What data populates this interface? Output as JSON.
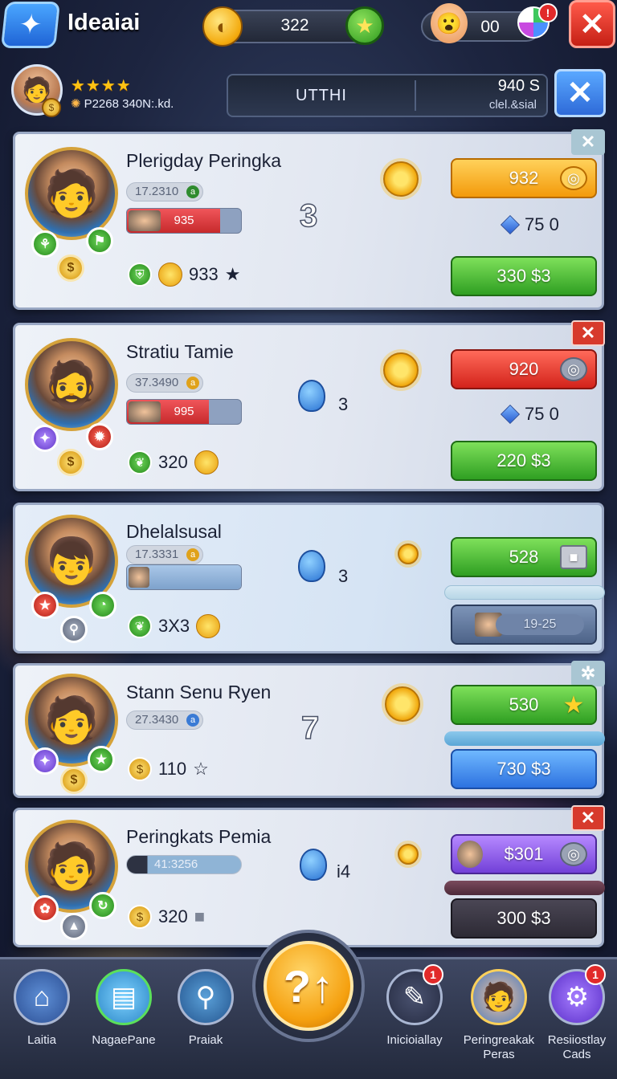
{
  "header": {
    "title": "Ideaiai",
    "logo_icon": "star-puzzle-icon",
    "coins": "322",
    "gems": "00",
    "globe_badge": "!",
    "close_label": "✕"
  },
  "profile": {
    "stars": "★★★★",
    "stats_text": "P2268  340N:.kd.",
    "search_text": "UTTHI",
    "stat_top": "940 S",
    "stat_bottom": "clel.&sial",
    "close_label": "✕"
  },
  "cards": [
    {
      "name": "Plerigday Peringka",
      "level": "17.2310",
      "hp": "935",
      "hp_fill": 0.82,
      "rank": "3",
      "stat": "933",
      "btn1": "932",
      "btn1_color": "yellow",
      "gem_line": "75 0",
      "btn2": "330 $3",
      "btn2_color": "green",
      "close_style": "teal"
    },
    {
      "name": "Stratiu Tamie",
      "level": "37.3490",
      "hp": "995",
      "hp_fill": 0.72,
      "rank": "3",
      "stat": "320",
      "btn1": "920",
      "btn1_color": "red",
      "gem_line": "75 0",
      "btn2": "220 $3",
      "btn2_color": "green",
      "close_style": "red"
    },
    {
      "name": "Dhelalsusal",
      "level": "17.3331",
      "hp": "",
      "hp_fill": 0,
      "rank": "3",
      "stat": "3X3",
      "btn1": "528",
      "btn1_color": "green",
      "time": "19-25",
      "close_style": "none"
    },
    {
      "name": "Stann Senu Ryen",
      "level": "27.3430",
      "rank": "7",
      "stat": "110",
      "btn1": "530",
      "btn1_color": "green",
      "btn2": "730 $3",
      "btn2_color": "blue",
      "close_style": "teal"
    },
    {
      "name": "Peringkats Pemia",
      "level": "41:3256",
      "rank": "i4",
      "stat": "320",
      "btn1": "$301",
      "btn1_color": "purple",
      "btn2": "300 $3",
      "btn2_color": "dark",
      "close_style": "red"
    }
  ],
  "nav": [
    {
      "label": "Laitia",
      "icon": "home-icon",
      "badge": ""
    },
    {
      "label": "NagaePane",
      "icon": "page-icon",
      "badge": ""
    },
    {
      "label": "Praiak",
      "icon": "search-icon",
      "badge": ""
    },
    {
      "label": "Inicioiallay",
      "icon": "tool-icon",
      "badge": "1"
    },
    {
      "label": "Peringreakak\nPeras",
      "icon": "avatar-icon",
      "badge": ""
    },
    {
      "label": "Resiiostlay\nCads",
      "icon": "gear-icon",
      "badge": "1"
    }
  ],
  "center_action": "?↑"
}
